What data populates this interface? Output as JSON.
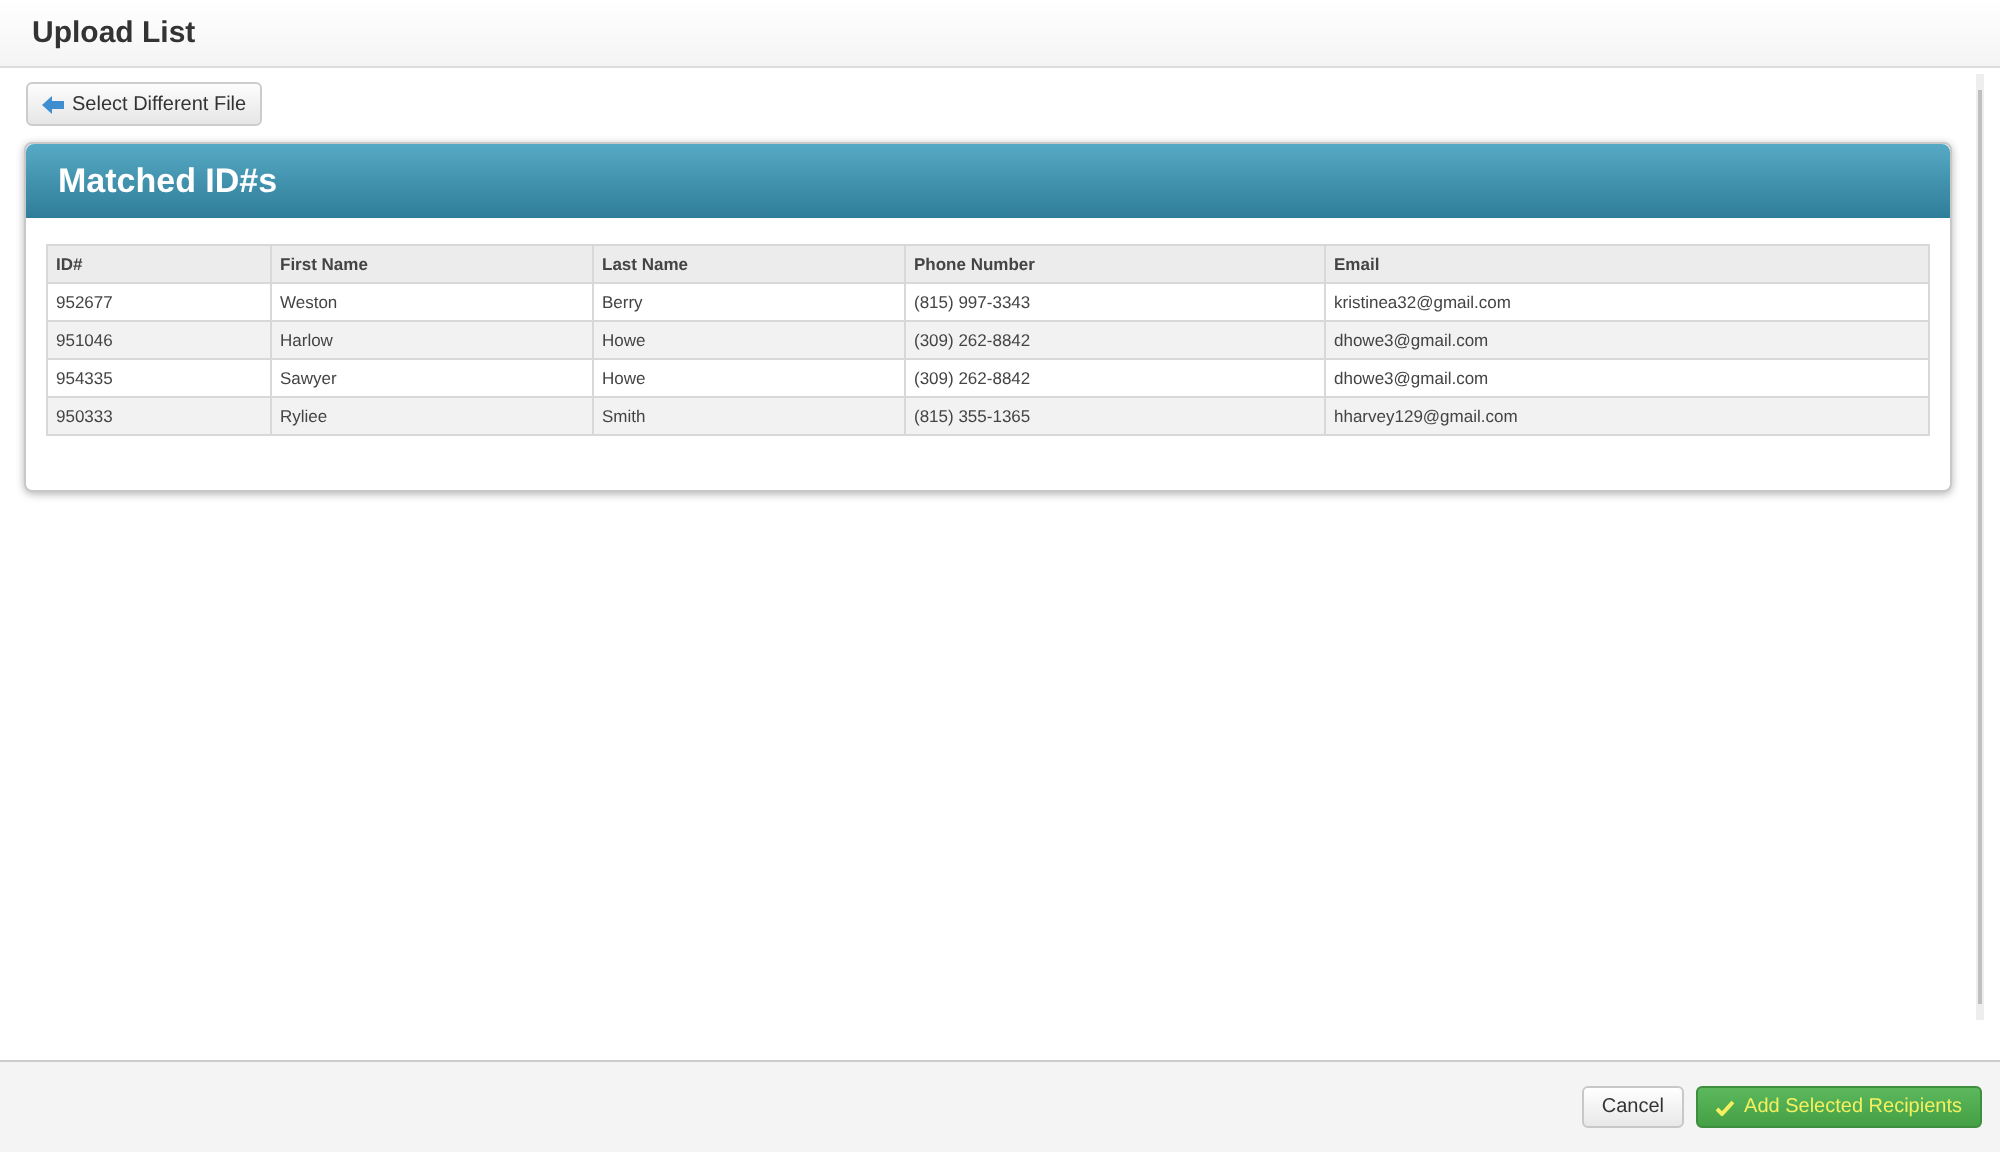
{
  "window": {
    "title": "Upload List"
  },
  "back_button": {
    "label": "Select Different File"
  },
  "panel": {
    "title": "Matched ID#s"
  },
  "table": {
    "columns": [
      "ID#",
      "First Name",
      "Last Name",
      "Phone Number",
      "Email"
    ],
    "rows": [
      [
        "952677",
        "Weston",
        "Berry",
        "(815) 997-3343",
        "kristinea32@gmail.com"
      ],
      [
        "951046",
        "Harlow",
        "Howe",
        "(309) 262-8842",
        "dhowe3@gmail.com"
      ],
      [
        "954335",
        "Sawyer",
        "Howe",
        "(309) 262-8842",
        "dhowe3@gmail.com"
      ],
      [
        "950333",
        "Ryliee",
        "Smith",
        "(815) 355-1365",
        "hharvey129@gmail.com"
      ]
    ]
  },
  "footer": {
    "buttons": [
      {
        "kind": "plain",
        "label": "Cancel"
      },
      {
        "kind": "primary",
        "label": "Add Selected Recipients"
      }
    ]
  }
}
